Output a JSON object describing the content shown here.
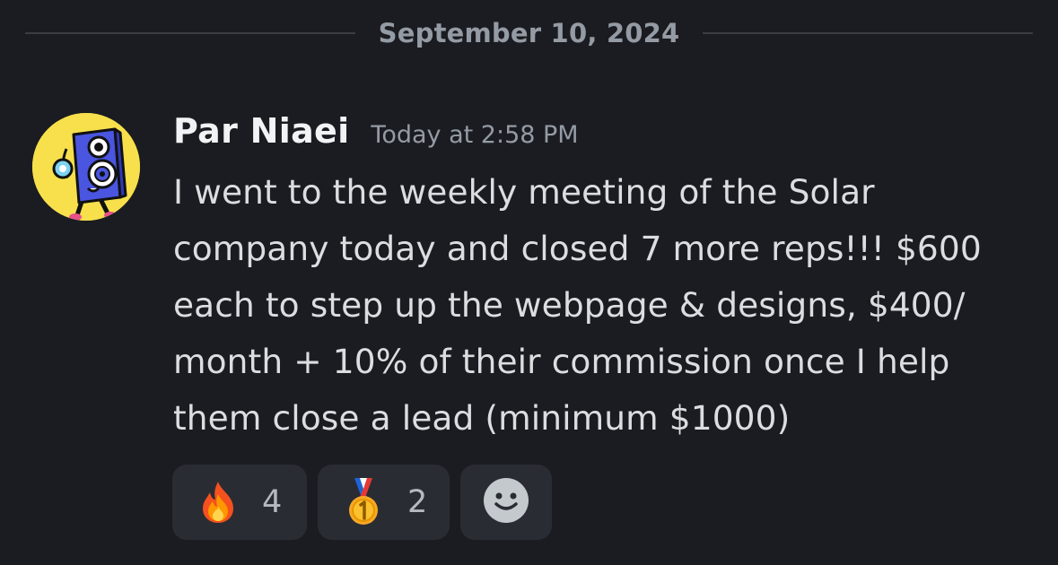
{
  "date_divider": "September 10, 2024",
  "message": {
    "author": "Par Niaei",
    "timestamp": "Today at 2:58 PM",
    "avatar_icon": "blue-speaker-character-avatar",
    "lines": [
      "I went to the weekly meeting of the Solar",
      "company today and closed 7 more reps!!! $600",
      "each to step up the webpage & designs, $400/",
      "month + 10% of their commission once I help",
      "them close a lead (minimum $1000)"
    ]
  },
  "reactions": [
    {
      "emoji": "fire-emoji",
      "count": "4"
    },
    {
      "emoji": "first-place-medal-emoji",
      "count": "2"
    },
    {
      "emoji": "add-reaction-smiley-icon"
    }
  ],
  "colors": {
    "background": "#1b1c21",
    "reaction_bg": "#2a2c33",
    "avatar_bg": "#f7e04b",
    "text": "#dbdee1",
    "muted": "#949ba4"
  }
}
